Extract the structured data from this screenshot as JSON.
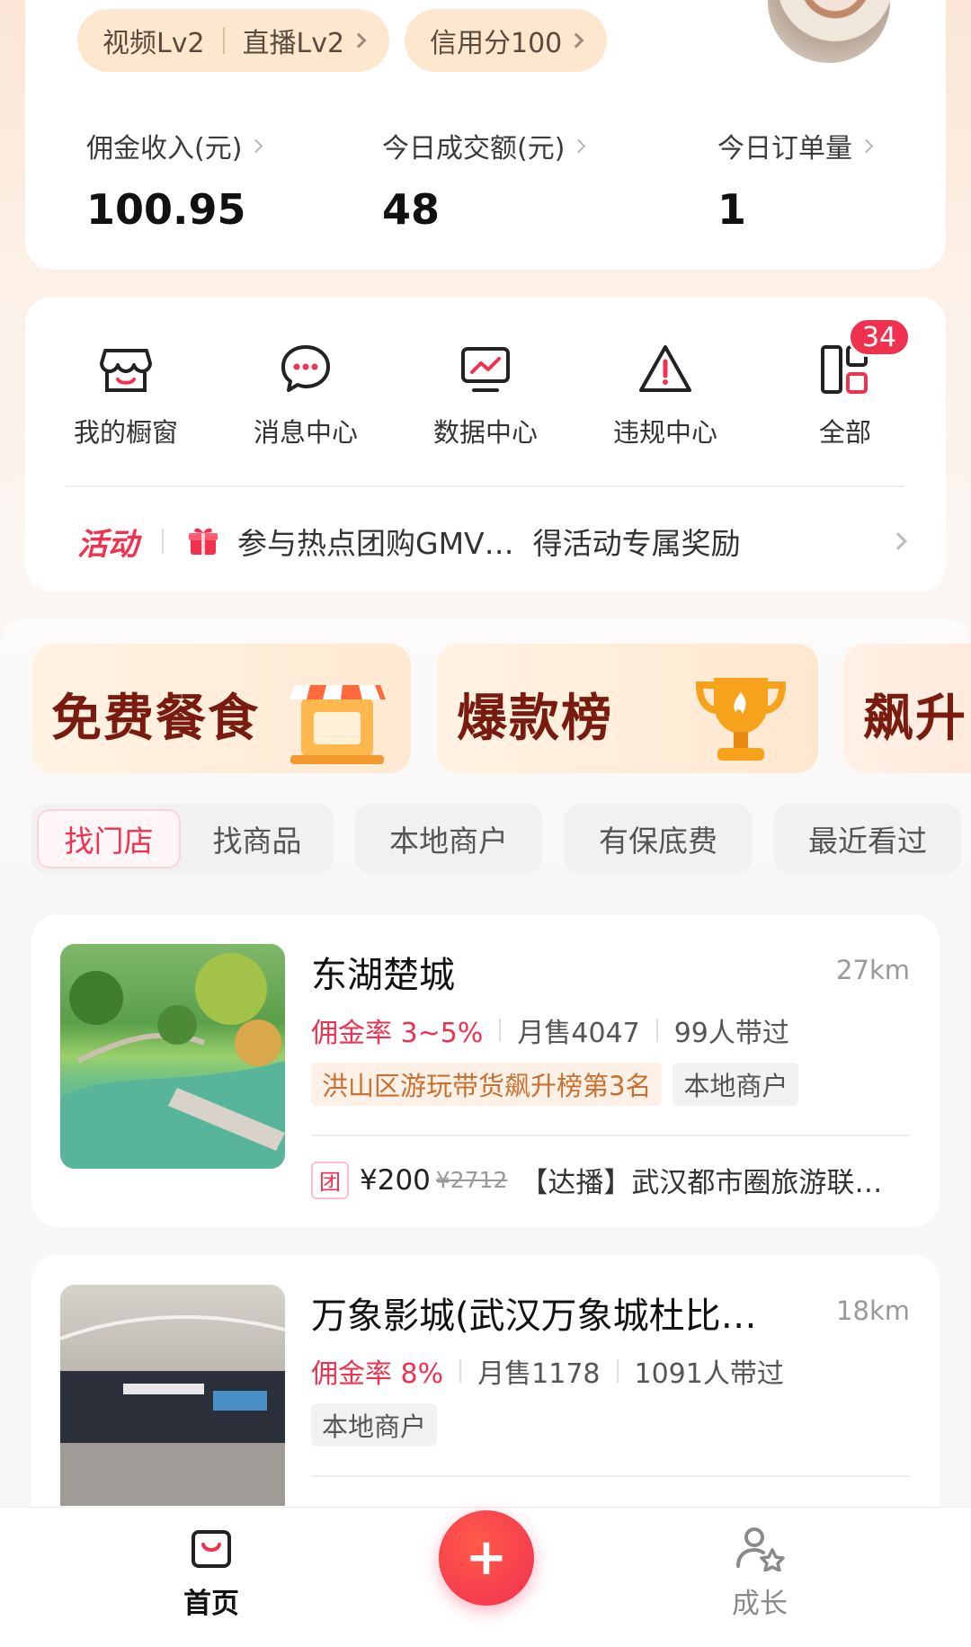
{
  "header": {
    "level_chip": {
      "video": "视频Lv2",
      "live": "直播Lv2"
    },
    "credit_chip": "信用分100",
    "stats": [
      {
        "label": "佣金收入(元)",
        "value": "100.95"
      },
      {
        "label": "今日成交额(元)",
        "value": "48"
      },
      {
        "label": "今日订单量",
        "value": "1"
      }
    ]
  },
  "tools": {
    "items": [
      {
        "label": "我的橱窗",
        "icon": "shop-icon"
      },
      {
        "label": "消息中心",
        "icon": "message-icon"
      },
      {
        "label": "数据中心",
        "icon": "chart-monitor-icon"
      },
      {
        "label": "违规中心",
        "icon": "warning-icon"
      },
      {
        "label": "全部",
        "icon": "grid-icon"
      }
    ],
    "all_badge": "34",
    "activity": {
      "tag": "活动",
      "text": "参与热点团购GMV…  得活动专属奖励"
    }
  },
  "promos": [
    {
      "label": "免费餐食"
    },
    {
      "label": "爆款榜"
    },
    {
      "label": "飙升"
    }
  ],
  "filters": {
    "segmented": [
      "找门店",
      "找商品"
    ],
    "active": "找门店",
    "pills": [
      "本地商户",
      "有保底费",
      "最近看过"
    ]
  },
  "stores": [
    {
      "name": "东湖楚城",
      "distance": "27km",
      "commission": "佣金率 3~5%",
      "monthly": "月售4047",
      "promoters": "99人带过",
      "rank_tag": "洪山区游玩带货飙升榜第3名",
      "local_tag": "本地商户",
      "deal": {
        "badge": "团",
        "price": "¥200",
        "orig": "¥2712",
        "title": "【达播】武汉都市圈旅游联…"
      }
    },
    {
      "name": "万象影城(武汉万象城杜比…",
      "distance": "18km",
      "commission": "佣金率 8%",
      "monthly": "月售1178",
      "promoters": "1091人带过",
      "local_tag": "本地商户"
    }
  ],
  "bottom_nav": {
    "home": "首页",
    "add": "+",
    "growth": "成长"
  },
  "colors": {
    "accent": "#f0314f",
    "orange_tag": "#c9702e"
  }
}
